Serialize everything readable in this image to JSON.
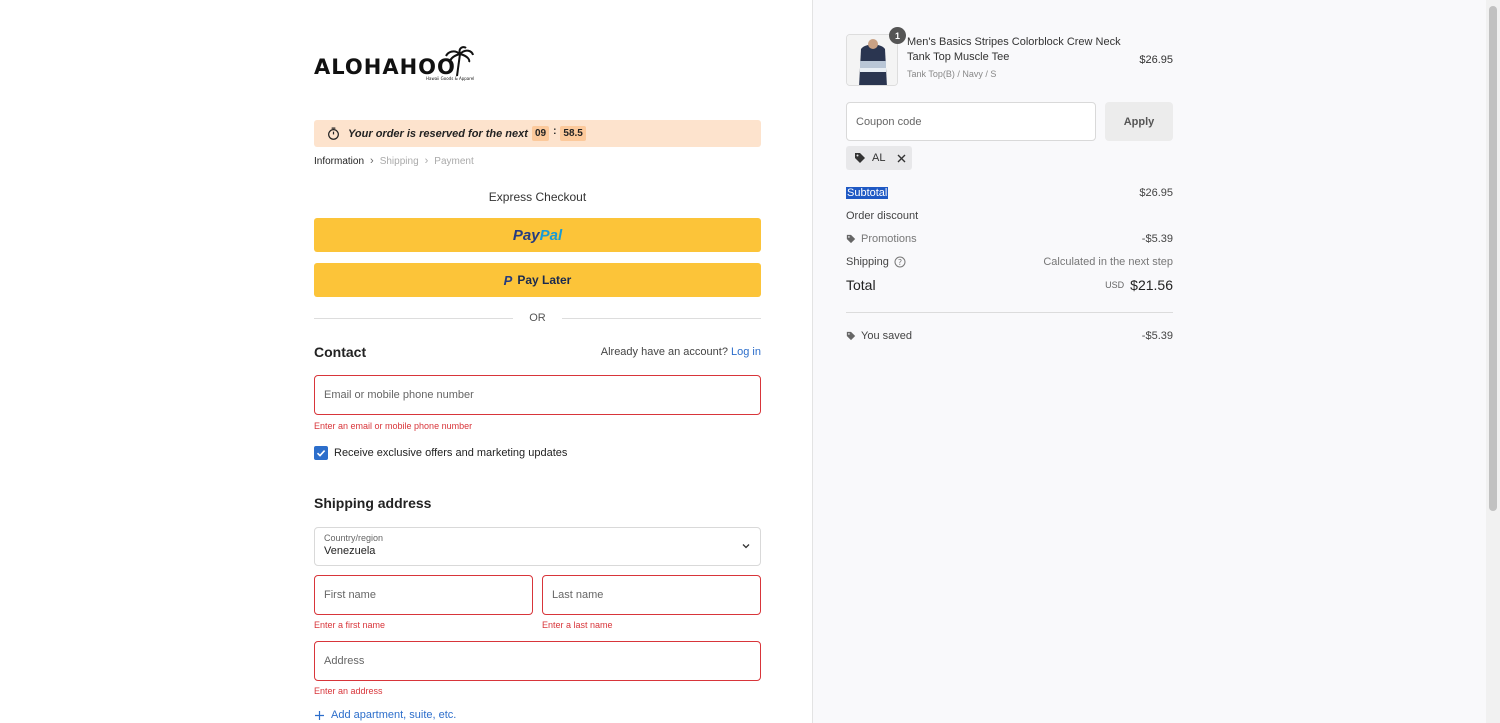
{
  "brand": {
    "name": "ALOHAHOO",
    "tagline": "Hawaii Goods & Apparel"
  },
  "timer": {
    "text": "Your order is reserved for the next",
    "minutes": "09",
    "seconds": "58.5"
  },
  "breadcrumb": {
    "step1": "Information",
    "step2": "Shipping",
    "step3": "Payment"
  },
  "express": {
    "title": "Express Checkout",
    "paypal_a": "Pay",
    "paypal_b": "Pal",
    "paylater": "Pay Later",
    "or": "OR"
  },
  "contact": {
    "heading": "Contact",
    "account_prompt": "Already have an account?",
    "login": "Log in",
    "email_placeholder": "Email or mobile phone number",
    "email_error": "Enter an email or mobile phone number",
    "marketing_label": "Receive exclusive offers and marketing updates"
  },
  "shipping": {
    "heading": "Shipping address",
    "country_label": "Country/region",
    "country_value": "Venezuela",
    "first_placeholder": "First name",
    "first_error": "Enter a first name",
    "last_placeholder": "Last name",
    "last_error": "Enter a last name",
    "address_placeholder": "Address",
    "address_error": "Enter an address",
    "add_apartment": "Add apartment, suite, etc."
  },
  "cart": {
    "item_title": "Men's Basics Stripes Colorblock Crew Neck Tank Top Muscle Tee",
    "item_variant": "Tank Top(B) / Navy / S",
    "item_qty": "1",
    "item_price": "$26.95"
  },
  "coupon": {
    "placeholder": "Coupon code",
    "apply": "Apply",
    "applied_code": "AL"
  },
  "summary": {
    "subtotal_label": "Subtotal",
    "subtotal_value": "$26.95",
    "order_discount_label": "Order discount",
    "promotions_label": "Promotions",
    "promotions_value": "-$5.39",
    "shipping_label": "Shipping",
    "shipping_value": "Calculated in the next step",
    "total_label": "Total",
    "total_currency": "USD",
    "total_value": "$21.56",
    "saved_label": "You saved",
    "saved_value": "-$5.39"
  },
  "colors": {
    "accent": "#2c6ecb",
    "error": "#d8353a",
    "paypal_yellow": "#fcc439",
    "timer_bg": "#fde3cd"
  }
}
